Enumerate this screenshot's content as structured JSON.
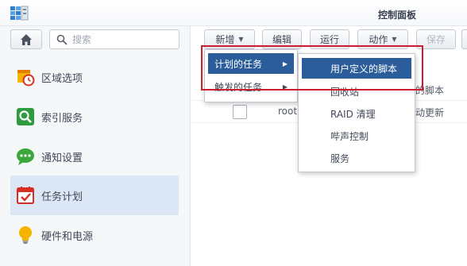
{
  "window": {
    "title": "控制面板"
  },
  "sidebar": {
    "search_placeholder": "搜索",
    "items": [
      {
        "label": "区域选项",
        "icon": "region-calendar-clock-icon",
        "active": false
      },
      {
        "label": "索引服务",
        "icon": "index-search-icon",
        "active": false
      },
      {
        "label": "通知设置",
        "icon": "chat-bubble-icon",
        "active": false
      },
      {
        "label": "任务计划",
        "icon": "calendar-check-icon",
        "active": true
      },
      {
        "label": "硬件和电源",
        "icon": "lightbulb-icon",
        "active": false
      }
    ]
  },
  "toolbar": {
    "create_label": "新增",
    "edit_label": "编辑",
    "run_label": "运行",
    "action_label": "动作",
    "save_label": "保存"
  },
  "table": {
    "rows": [
      {
        "user": "",
        "task": "的脚本"
      },
      {
        "user": "root",
        "task": "动更新"
      }
    ]
  },
  "create_menu": {
    "items": [
      {
        "label": "计划的任务"
      },
      {
        "label": "触发的任务"
      }
    ]
  },
  "submenu": {
    "items": [
      {
        "label": "用户定义的脚本"
      },
      {
        "label": "回收站"
      },
      {
        "label": "RAID 清理"
      },
      {
        "label": "哔声控制"
      },
      {
        "label": "服务"
      }
    ]
  },
  "colors": {
    "accent": "#2b5d9a",
    "sidebar_active": "#dbe7f5",
    "highlight_border": "#c8202e"
  }
}
